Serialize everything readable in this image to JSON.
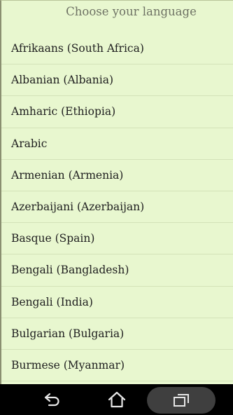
{
  "dialog": {
    "title": "Choose your language",
    "languages": [
      "Afrikaans (South Africa)",
      "Albanian (Albania)",
      "Amharic (Ethiopia)",
      "Arabic",
      "Armenian (Armenia)",
      "Azerbaijani (Azerbaijan)",
      "Basque (Spain)",
      "Bengali (Bangladesh)",
      "Bengali (India)",
      "Bulgarian (Bulgaria)",
      "Burmese (Myanmar)"
    ]
  },
  "navbar": {
    "back_icon": "back-arrow-icon",
    "home_icon": "home-icon",
    "recent_icon": "recent-apps-icon"
  },
  "colors": {
    "dialog_background": "#e8f7cf",
    "divider": "#d3e2b8",
    "title_text": "#6e7264",
    "item_text": "#202020",
    "navbar_background": "#000000"
  }
}
